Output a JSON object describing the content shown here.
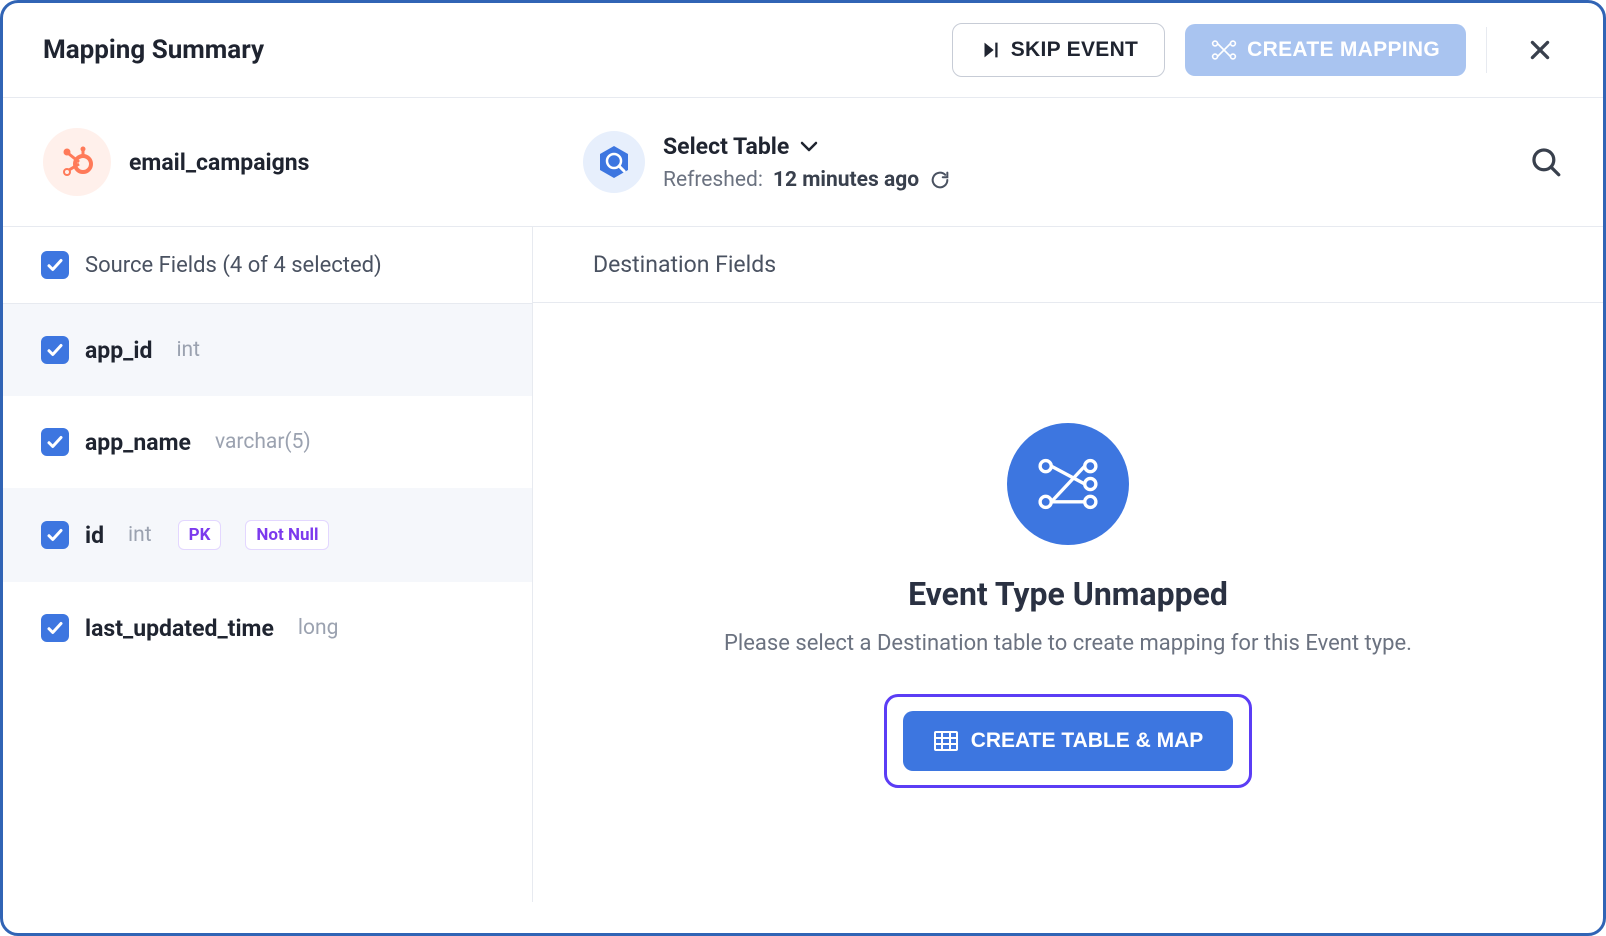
{
  "header": {
    "title": "Mapping Summary",
    "skip_label": "SKIP EVENT",
    "create_mapping_label": "CREATE MAPPING"
  },
  "source": {
    "name": "email_campaigns",
    "icon": "hubspot-icon"
  },
  "destination": {
    "icon": "bigquery-icon",
    "select_label": "Select Table",
    "refreshed_prefix": "Refreshed:",
    "refreshed_time": "12 minutes ago"
  },
  "left": {
    "header_label": "Source Fields (4 of 4 selected)",
    "fields": [
      {
        "name": "app_id",
        "type": "int",
        "pk": false,
        "notnull": false
      },
      {
        "name": "app_name",
        "type": "varchar(5)",
        "pk": false,
        "notnull": false
      },
      {
        "name": "id",
        "type": "int",
        "pk": true,
        "notnull": true
      },
      {
        "name": "last_updated_time",
        "type": "long",
        "pk": false,
        "notnull": false
      }
    ],
    "pk_label": "PK",
    "notnull_label": "Not Null"
  },
  "right": {
    "header_label": "Destination Fields",
    "empty_title": "Event Type Unmapped",
    "empty_desc": "Please select a Destination table to create mapping for this Event type.",
    "cta_label": "CREATE TABLE & MAP"
  },
  "colors": {
    "primary": "#3d76e0",
    "primary_light": "#a9c4f0",
    "accent_purple": "#5b3df5",
    "hubspot_orange": "#ff7a59"
  }
}
